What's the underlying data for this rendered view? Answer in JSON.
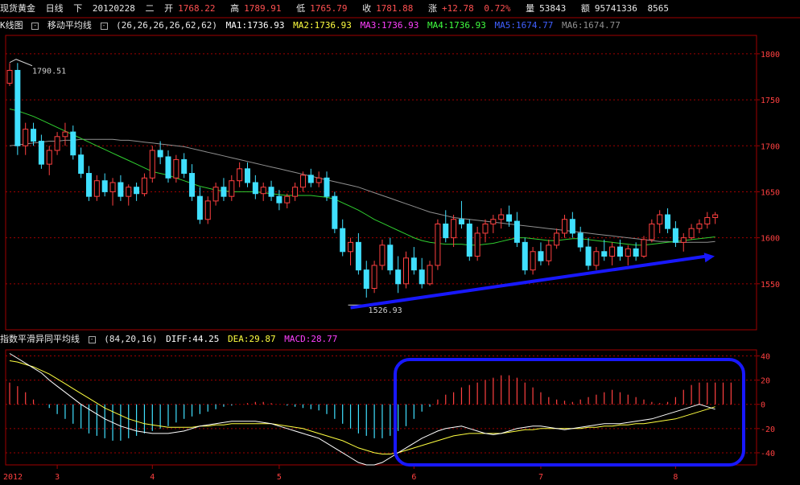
{
  "quote": {
    "name": "现货黄金",
    "period": "日线",
    "dir": "下",
    "date": "20120228",
    "weekday": "二",
    "open_label": "开",
    "open": "1768.22",
    "high_label": "高",
    "high": "1789.91",
    "low_label": "低",
    "low": "1765.79",
    "close_label": "收",
    "close": "1781.88",
    "chg_label": "涨",
    "chg": "+12.78",
    "chg_pct": "0.72%",
    "vol_label": "量",
    "vol": "53843",
    "amt_label": "额",
    "amt": "95741336",
    "amt_extra": "8565"
  },
  "ma_bar": {
    "chart_name": "K线图",
    "ind_name": "移动平均线",
    "params": "(26,26,26,26,62,62)",
    "ma1": "MA1:1736.93",
    "ma2": "MA2:1736.93",
    "ma3": "MA3:1736.93",
    "ma4": "MA4:1736.93",
    "ma5": "MA5:1674.77",
    "ma6": "MA6:1674.77"
  },
  "macd_bar": {
    "ind_name": "指数平滑异同平均线",
    "params": "(84,20,16)",
    "diff": "DIFF:44.25",
    "dea": "DEA:29.87",
    "macd": "MACD:28.77"
  },
  "annotations": {
    "high_mark": "1790.51",
    "low_mark": "1526.93"
  },
  "colors": {
    "up": "#ff4040",
    "down": "#40e0ff",
    "ma_green": "#30d030",
    "ma_gray": "#909090",
    "grid": "#a00000",
    "trend_arrow": "#1818ff",
    "highlight_box": "#1818ff",
    "diff_line": "#ffffff",
    "dea_line": "#ffff40"
  },
  "chart_data": [
    {
      "type": "candlestick",
      "ylim": [
        1500,
        1820
      ],
      "yticks": [
        "1800",
        "1750",
        "1700",
        "1650",
        "1600",
        "1550"
      ],
      "xticks": [
        "2012",
        "3",
        "4",
        "5",
        "6",
        "7",
        "8"
      ],
      "candles": [
        [
          1768,
          1790,
          1765,
          1782
        ],
        [
          1782,
          1790,
          1690,
          1700
        ],
        [
          1700,
          1725,
          1690,
          1718
        ],
        [
          1718,
          1725,
          1700,
          1705
        ],
        [
          1705,
          1712,
          1675,
          1680
        ],
        [
          1680,
          1700,
          1668,
          1695
        ],
        [
          1695,
          1715,
          1690,
          1710
        ],
        [
          1710,
          1725,
          1700,
          1715
        ],
        [
          1715,
          1722,
          1685,
          1690
        ],
        [
          1690,
          1698,
          1665,
          1670
        ],
        [
          1670,
          1678,
          1640,
          1645
        ],
        [
          1645,
          1668,
          1640,
          1662
        ],
        [
          1662,
          1670,
          1645,
          1650
        ],
        [
          1650,
          1665,
          1635,
          1660
        ],
        [
          1660,
          1668,
          1640,
          1645
        ],
        [
          1645,
          1658,
          1635,
          1655
        ],
        [
          1655,
          1660,
          1640,
          1648
        ],
        [
          1648,
          1670,
          1645,
          1665
        ],
        [
          1665,
          1700,
          1660,
          1695
        ],
        [
          1695,
          1705,
          1680,
          1688
        ],
        [
          1688,
          1695,
          1660,
          1665
        ],
        [
          1665,
          1690,
          1660,
          1685
        ],
        [
          1685,
          1692,
          1665,
          1670
        ],
        [
          1670,
          1680,
          1640,
          1645
        ],
        [
          1645,
          1655,
          1615,
          1620
        ],
        [
          1620,
          1645,
          1615,
          1640
        ],
        [
          1640,
          1660,
          1635,
          1655
        ],
        [
          1655,
          1665,
          1640,
          1645
        ],
        [
          1645,
          1668,
          1640,
          1662
        ],
        [
          1662,
          1682,
          1655,
          1675
        ],
        [
          1675,
          1682,
          1655,
          1660
        ],
        [
          1660,
          1668,
          1642,
          1648
        ],
        [
          1648,
          1660,
          1640,
          1655
        ],
        [
          1655,
          1662,
          1640,
          1645
        ],
        [
          1645,
          1652,
          1630,
          1638
        ],
        [
          1638,
          1648,
          1632,
          1645
        ],
        [
          1645,
          1660,
          1640,
          1655
        ],
        [
          1655,
          1672,
          1650,
          1668
        ],
        [
          1668,
          1675,
          1655,
          1660
        ],
        [
          1660,
          1672,
          1655,
          1665
        ],
        [
          1665,
          1672,
          1640,
          1645
        ],
        [
          1645,
          1650,
          1605,
          1610
        ],
        [
          1610,
          1620,
          1580,
          1585
        ],
        [
          1585,
          1600,
          1570,
          1595
        ],
        [
          1595,
          1605,
          1560,
          1565
        ],
        [
          1565,
          1575,
          1535,
          1545
        ],
        [
          1545,
          1575,
          1540,
          1570
        ],
        [
          1570,
          1598,
          1565,
          1592
        ],
        [
          1592,
          1600,
          1560,
          1565
        ],
        [
          1565,
          1580,
          1540,
          1550
        ],
        [
          1550,
          1585,
          1545,
          1578
        ],
        [
          1578,
          1590,
          1560,
          1565
        ],
        [
          1565,
          1578,
          1545,
          1550
        ],
        [
          1550,
          1575,
          1548,
          1570
        ],
        [
          1570,
          1620,
          1565,
          1615
        ],
        [
          1615,
          1630,
          1595,
          1600
        ],
        [
          1600,
          1625,
          1590,
          1620
        ],
        [
          1620,
          1640,
          1610,
          1615
        ],
        [
          1615,
          1620,
          1575,
          1580
        ],
        [
          1580,
          1612,
          1575,
          1605
        ],
        [
          1605,
          1620,
          1595,
          1615
        ],
        [
          1615,
          1625,
          1605,
          1620
        ],
        [
          1620,
          1632,
          1610,
          1625
        ],
        [
          1625,
          1635,
          1612,
          1618
        ],
        [
          1618,
          1628,
          1590,
          1595
        ],
        [
          1595,
          1600,
          1560,
          1565
        ],
        [
          1565,
          1590,
          1560,
          1585
        ],
        [
          1585,
          1595,
          1570,
          1575
        ],
        [
          1575,
          1598,
          1570,
          1592
        ],
        [
          1592,
          1610,
          1588,
          1605
        ],
        [
          1605,
          1625,
          1600,
          1620
        ],
        [
          1620,
          1628,
          1600,
          1605
        ],
        [
          1605,
          1612,
          1585,
          1590
        ],
        [
          1590,
          1600,
          1565,
          1570
        ],
        [
          1570,
          1590,
          1565,
          1585
        ],
        [
          1585,
          1598,
          1575,
          1580
        ],
        [
          1580,
          1595,
          1570,
          1590
        ],
        [
          1590,
          1598,
          1575,
          1580
        ],
        [
          1580,
          1592,
          1570,
          1588
        ],
        [
          1588,
          1595,
          1575,
          1580
        ],
        [
          1580,
          1602,
          1578,
          1598
        ],
        [
          1598,
          1620,
          1595,
          1615
        ],
        [
          1615,
          1630,
          1605,
          1625
        ],
        [
          1625,
          1632,
          1605,
          1610
        ],
        [
          1610,
          1618,
          1590,
          1595
        ],
        [
          1595,
          1605,
          1585,
          1600
        ],
        [
          1600,
          1615,
          1598,
          1610
        ],
        [
          1610,
          1620,
          1605,
          1615
        ],
        [
          1615,
          1628,
          1610,
          1622
        ],
        [
          1622,
          1628,
          1615,
          1625
        ]
      ],
      "ma_green": [
        1740,
        1738,
        1735,
        1732,
        1728,
        1724,
        1720,
        1716,
        1712,
        1708,
        1704,
        1700,
        1696,
        1692,
        1688,
        1684,
        1680,
        1676,
        1672,
        1670,
        1668,
        1665,
        1662,
        1659,
        1656,
        1654,
        1652,
        1651,
        1650,
        1650,
        1650,
        1650,
        1649,
        1648,
        1647,
        1646,
        1646,
        1646,
        1646,
        1645,
        1644,
        1642,
        1638,
        1634,
        1630,
        1625,
        1620,
        1616,
        1612,
        1608,
        1604,
        1600,
        1597,
        1595,
        1594,
        1593,
        1593,
        1593,
        1592,
        1592,
        1593,
        1594,
        1596,
        1598,
        1600,
        1600,
        1599,
        1598,
        1597,
        1597,
        1598,
        1599,
        1599,
        1598,
        1597,
        1596,
        1595,
        1594,
        1593,
        1592,
        1592,
        1593,
        1594,
        1595,
        1596,
        1597,
        1598,
        1599,
        1600,
        1601
      ],
      "ma_gray": [
        1700,
        1701,
        1702,
        1703,
        1704,
        1705,
        1705,
        1706,
        1706,
        1707,
        1707,
        1707,
        1707,
        1707,
        1706,
        1706,
        1705,
        1704,
        1703,
        1702,
        1701,
        1700,
        1699,
        1697,
        1695,
        1693,
        1691,
        1689,
        1687,
        1685,
        1683,
        1681,
        1679,
        1677,
        1675,
        1673,
        1671,
        1669,
        1667,
        1665,
        1663,
        1661,
        1659,
        1657,
        1655,
        1652,
        1649,
        1646,
        1643,
        1640,
        1637,
        1634,
        1631,
        1628,
        1626,
        1624,
        1622,
        1621,
        1620,
        1619,
        1618,
        1617,
        1616,
        1615,
        1614,
        1613,
        1612,
        1611,
        1610,
        1609,
        1608,
        1607,
        1606,
        1605,
        1604,
        1603,
        1602,
        1601,
        1600,
        1599,
        1598,
        1597,
        1596,
        1596,
        1595,
        1595,
        1595,
        1595,
        1595,
        1596
      ]
    },
    {
      "type": "macd",
      "ylim": [
        -50,
        45
      ],
      "yticks": [
        "40",
        "20",
        "0",
        "-20",
        "-40"
      ],
      "histogram": [
        18,
        15,
        10,
        4,
        0,
        -3,
        -8,
        -12,
        -16,
        -20,
        -24,
        -26,
        -28,
        -30,
        -30,
        -28,
        -26,
        -24,
        -22,
        -20,
        -18,
        -15,
        -12,
        -10,
        -8,
        -6,
        -4,
        -2,
        -1,
        0,
        1,
        2,
        2,
        1,
        0,
        -1,
        -2,
        -3,
        -4,
        -5,
        -8,
        -12,
        -16,
        -20,
        -24,
        -26,
        -28,
        -28,
        -26,
        -22,
        -18,
        -12,
        -6,
        -2,
        4,
        8,
        10,
        14,
        16,
        18,
        20,
        22,
        24,
        24,
        22,
        18,
        14,
        10,
        6,
        4,
        3,
        2,
        4,
        6,
        8,
        10,
        12,
        10,
        8,
        6,
        4,
        2,
        1,
        2,
        6,
        12,
        16,
        18,
        18,
        18,
        18,
        18
      ],
      "diff": [
        42,
        38,
        34,
        30,
        26,
        20,
        15,
        10,
        5,
        0,
        -4,
        -8,
        -12,
        -15,
        -18,
        -20,
        -22,
        -23,
        -24,
        -24,
        -24,
        -23,
        -22,
        -20,
        -18,
        -17,
        -16,
        -15,
        -14,
        -14,
        -14,
        -14,
        -15,
        -16,
        -18,
        -20,
        -22,
        -24,
        -26,
        -28,
        -32,
        -36,
        -40,
        -44,
        -48,
        -50,
        -50,
        -48,
        -44,
        -40,
        -36,
        -32,
        -28,
        -25,
        -22,
        -20,
        -19,
        -18,
        -20,
        -22,
        -24,
        -25,
        -24,
        -22,
        -20,
        -19,
        -18,
        -18,
        -19,
        -20,
        -21,
        -20,
        -19,
        -18,
        -17,
        -16,
        -16,
        -16,
        -15,
        -14,
        -13,
        -12,
        -10,
        -8,
        -6,
        -4,
        -2,
        0,
        -2,
        -4
      ],
      "dea": [
        36,
        35,
        33,
        31,
        28,
        25,
        21,
        17,
        13,
        9,
        5,
        1,
        -3,
        -6,
        -9,
        -12,
        -14,
        -16,
        -17,
        -18,
        -19,
        -19,
        -19,
        -19,
        -18,
        -18,
        -17,
        -17,
        -16,
        -16,
        -16,
        -16,
        -16,
        -16,
        -17,
        -18,
        -19,
        -20,
        -22,
        -24,
        -26,
        -28,
        -30,
        -33,
        -36,
        -38,
        -40,
        -41,
        -41,
        -40,
        -38,
        -36,
        -34,
        -32,
        -30,
        -28,
        -26,
        -25,
        -24,
        -24,
        -24,
        -24,
        -24,
        -23,
        -22,
        -21,
        -21,
        -20,
        -20,
        -20,
        -20,
        -20,
        -20,
        -19,
        -19,
        -18,
        -18,
        -17,
        -17,
        -16,
        -16,
        -15,
        -14,
        -13,
        -12,
        -10,
        -8,
        -6,
        -4,
        -2
      ]
    }
  ]
}
